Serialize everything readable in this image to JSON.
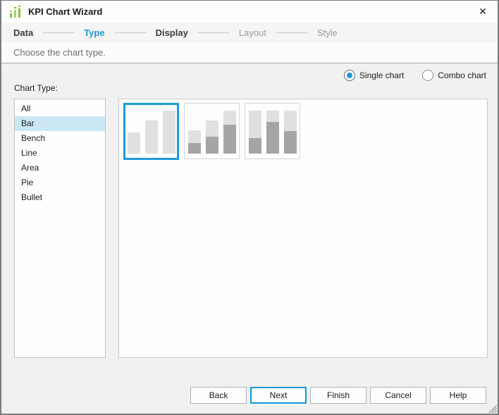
{
  "window": {
    "title": "KPI Chart Wizard",
    "close_glyph": "✕"
  },
  "steps": {
    "items": [
      {
        "label": "Data",
        "state": "done"
      },
      {
        "label": "Type",
        "state": "active"
      },
      {
        "label": "Display",
        "state": "done"
      },
      {
        "label": "Layout",
        "state": "todo"
      },
      {
        "label": "Style",
        "state": "todo"
      }
    ],
    "current": "Type"
  },
  "subtitle": "Choose the chart type.",
  "chart_mode": {
    "options": [
      {
        "label": "Single chart",
        "selected": true
      },
      {
        "label": "Combo chart",
        "selected": false
      }
    ]
  },
  "chart_type": {
    "label": "Chart Type:",
    "selected": "Bar",
    "items": [
      "All",
      "Bar",
      "Bench",
      "Line",
      "Area",
      "Pie",
      "Bullet"
    ]
  },
  "thumbnails": {
    "selected_index": 0,
    "items": [
      {
        "name": "bar-chart-plain"
      },
      {
        "name": "bar-chart-stacked-ascending"
      },
      {
        "name": "bar-chart-full-stacked"
      }
    ]
  },
  "footer": {
    "buttons": [
      "Back",
      "Next",
      "Finish",
      "Cancel",
      "Help"
    ],
    "default_button": "Next"
  },
  "colors": {
    "accent": "#1d9bd8",
    "selection_bg": "#cbe7f6",
    "icon_green": "#85c441",
    "bar_light": "#dfe0df",
    "bar_dark": "#a4a5a4"
  }
}
